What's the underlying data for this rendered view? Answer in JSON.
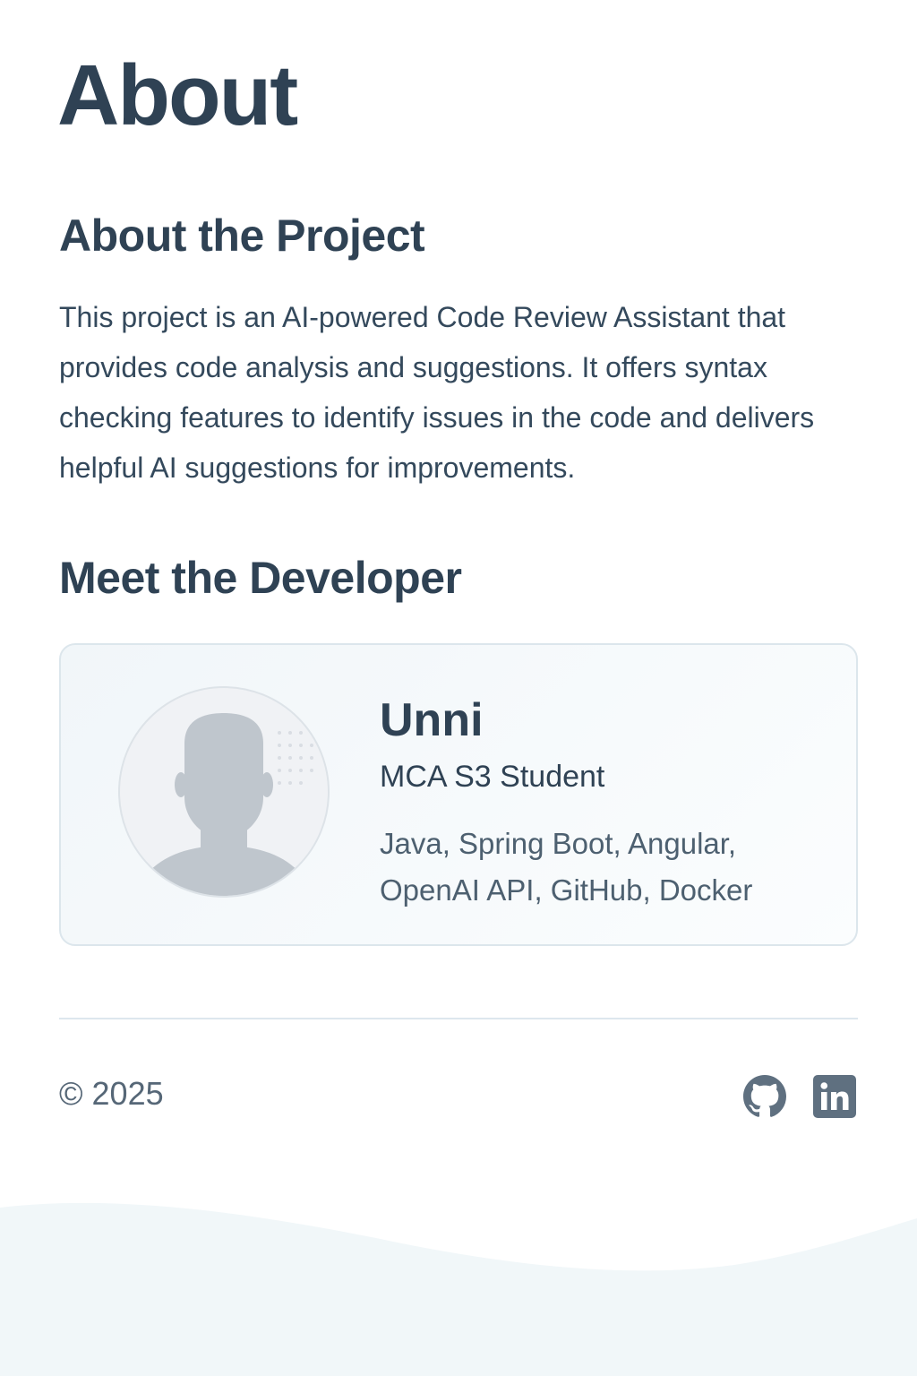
{
  "page": {
    "title": "About"
  },
  "project": {
    "heading": "About the Project",
    "description": "This project is an AI-powered Code Review Assistant that provides code analysis and suggestions. It offers syntax checking features to identify issues in the code and delivers helpful AI suggestions for improvements."
  },
  "developer": {
    "heading": "Meet the Developer",
    "name": "Unni",
    "role": "MCA S3 Student",
    "skills_line1": "Java, Spring Boot, Angular,",
    "skills_line2": "OpenAI API, GitHub, Docker",
    "avatar_icon": "person-silhouette-icon"
  },
  "footer": {
    "copyright": "© 2025",
    "links": [
      {
        "icon": "github-icon"
      },
      {
        "icon": "linkedin-icon"
      }
    ]
  },
  "colors": {
    "heading": "#2f4254",
    "body_text": "#34495c",
    "muted_text": "#566777",
    "card_border": "#dce6ec",
    "icon": "#5f7080"
  }
}
